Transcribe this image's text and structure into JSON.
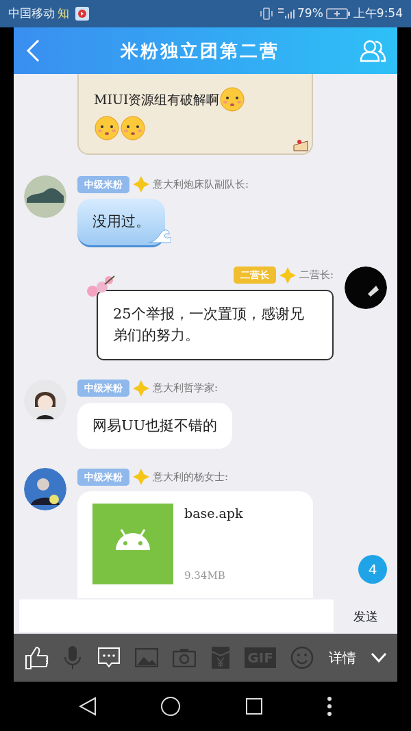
{
  "status_bar": {
    "carrier": "中国移动",
    "app_label": "知",
    "battery": "79%",
    "time": "上午9:54"
  },
  "header": {
    "title": "米粉独立团第二营"
  },
  "messages": [
    {
      "kind": "sticker",
      "text": "MIUI资源组有破解啊"
    },
    {
      "kind": "incoming",
      "badge": {
        "label": "中级米粉",
        "color": "#8fb8ec"
      },
      "sender": "意大利炮床队副队长:",
      "text": "没用过。"
    },
    {
      "kind": "outgoing",
      "badge": {
        "label": "二营长",
        "color": "#f0be2e"
      },
      "sender": "二营长:",
      "text": "25个举报，一次置顶，感谢兄弟们的努力。"
    },
    {
      "kind": "incoming",
      "badge": {
        "label": "中级米粉",
        "color": "#8fb8ec"
      },
      "sender": "意大利哲学家:",
      "text": "网易UU也挺不错的"
    },
    {
      "kind": "file",
      "badge": {
        "label": "中级米粉",
        "color": "#8fb8ec"
      },
      "sender": "意大利的杨女士:",
      "file_name": "base.apk",
      "file_size": "9.34MB"
    }
  ],
  "unread_badge": "4",
  "composer": {
    "send_label": "发送",
    "send_disabled": true
  },
  "toolbar": {
    "gif_label": "GIF",
    "details_label": "详情"
  }
}
